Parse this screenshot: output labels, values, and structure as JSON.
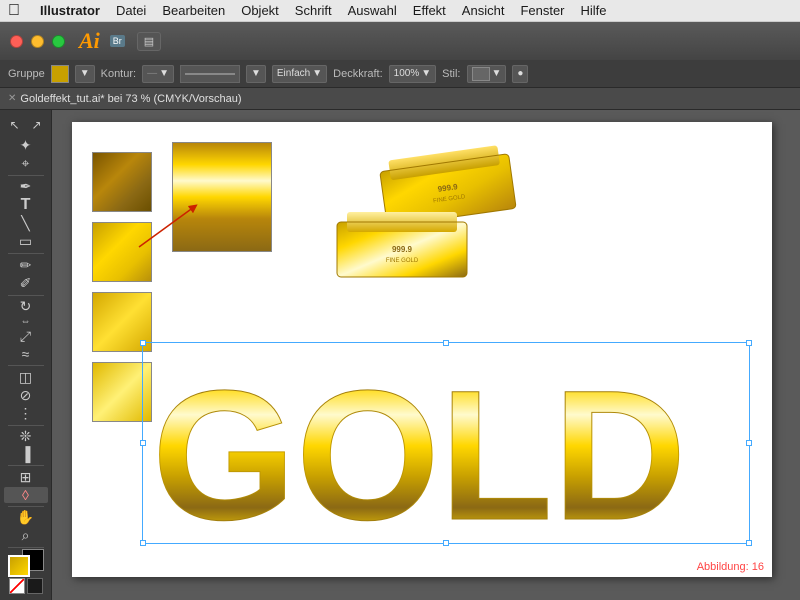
{
  "menubar": {
    "apple": "&#63743;",
    "items": [
      {
        "label": "Illustrator",
        "bold": true
      },
      {
        "label": "Datei"
      },
      {
        "label": "Bearbeiten"
      },
      {
        "label": "Objekt"
      },
      {
        "label": "Schrift"
      },
      {
        "label": "Auswahl"
      },
      {
        "label": "Effekt"
      },
      {
        "label": "Ansicht"
      },
      {
        "label": "Fenster"
      },
      {
        "label": "Hilfe"
      }
    ]
  },
  "titlebar": {
    "logo": "Ai",
    "layout_btn": "&#9636;"
  },
  "optionsbar": {
    "group_label": "Gruppe",
    "kontur_label": "Kontur:",
    "einfach_label": "Einfach",
    "deckkraft_label": "Deckkraft:",
    "deckkraft_value": "100%",
    "stil_label": "Stil:"
  },
  "tabbar": {
    "title": "Goldeffekt_tut.ai* bei 73 % (CMYK/Vorschau)"
  },
  "canvas": {
    "abbildung": "Abbildung: 16"
  },
  "toolbar": {
    "tools": [
      {
        "name": "select",
        "icon": "↖"
      },
      {
        "name": "direct-select",
        "icon": "↗"
      },
      {
        "name": "magic-wand",
        "icon": "✦"
      },
      {
        "name": "lasso",
        "icon": "⌖"
      },
      {
        "name": "pen",
        "icon": "✒"
      },
      {
        "name": "type",
        "icon": "T"
      },
      {
        "name": "line",
        "icon": "╲"
      },
      {
        "name": "rect",
        "icon": "▭"
      },
      {
        "name": "paintbrush",
        "icon": "✏"
      },
      {
        "name": "pencil",
        "icon": "✐"
      },
      {
        "name": "rotate",
        "icon": "↻"
      },
      {
        "name": "reflect",
        "icon": "⇔"
      },
      {
        "name": "scale",
        "icon": "⤢"
      },
      {
        "name": "warp",
        "icon": "≈"
      },
      {
        "name": "gradient",
        "icon": "◫"
      },
      {
        "name": "eyedropper",
        "icon": "⊘"
      },
      {
        "name": "blend",
        "icon": "⋮"
      },
      {
        "name": "symbol",
        "icon": "❊"
      },
      {
        "name": "column-graph",
        "icon": "▐"
      },
      {
        "name": "artboard",
        "icon": "⊞"
      },
      {
        "name": "slice",
        "icon": "◊"
      },
      {
        "name": "hand",
        "icon": "✋"
      },
      {
        "name": "zoom",
        "icon": "⌕"
      }
    ]
  }
}
